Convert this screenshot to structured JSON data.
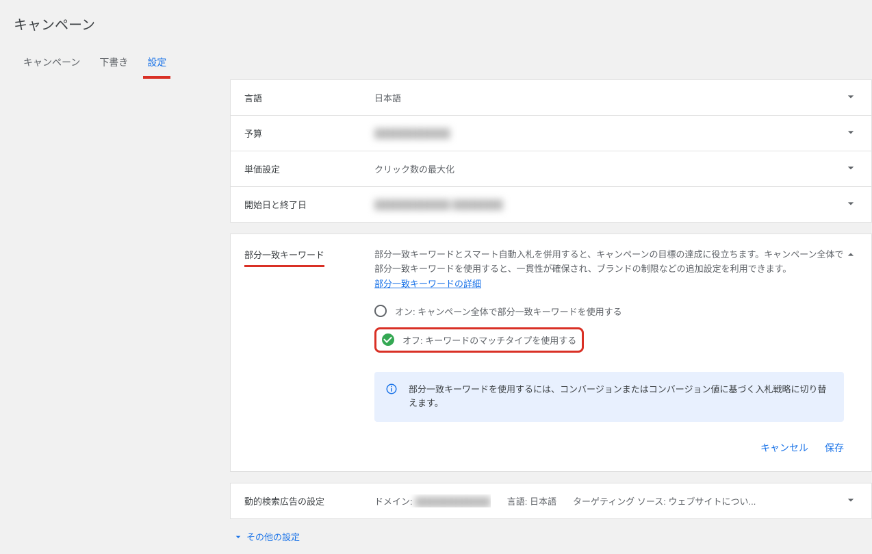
{
  "header": {
    "title": "キャンペーン"
  },
  "tabs": {
    "items": [
      "キャンペーン",
      "下書き",
      "設定"
    ],
    "active": 2
  },
  "sections": {
    "language": {
      "label": "言語",
      "value": "日本語"
    },
    "budget": {
      "label": "予算",
      "value": "████████████"
    },
    "bidding": {
      "label": "単価設定",
      "value": "クリック数の最大化"
    },
    "dates": {
      "label": "開始日と終了日",
      "value": "████████████  ████████"
    }
  },
  "broadMatch": {
    "label": "部分一致キーワード",
    "description": "部分一致キーワードとスマート自動入札を併用すると、キャンペーンの目標の達成に役立ちます。キャンペーン全体で部分一致キーワードを使用すると、一貫性が確保され、ブランドの制限などの追加設定を利用できます。",
    "detailsLink": "部分一致キーワードの詳細",
    "optionOn": "オン: キャンペーン全体で部分一致キーワードを使用する",
    "optionOff": "オフ: キーワードのマッチタイプを使用する",
    "infoText": "部分一致キーワードを使用するには、コンバージョンまたはコンバージョン値に基づく入札戦略に切り替えます。"
  },
  "dsa": {
    "label": "動的検索広告の設定",
    "domainLabel": "ドメイン:",
    "domainValue": "████████████",
    "langLabel": "言語:",
    "langValue": "日本語",
    "sourceLabel": "ターゲティング ソース:",
    "sourceValue": "ウェブサイトについ..."
  },
  "actions": {
    "cancel": "キャンセル",
    "save": "保存"
  },
  "moreSettings": "その他の設定"
}
